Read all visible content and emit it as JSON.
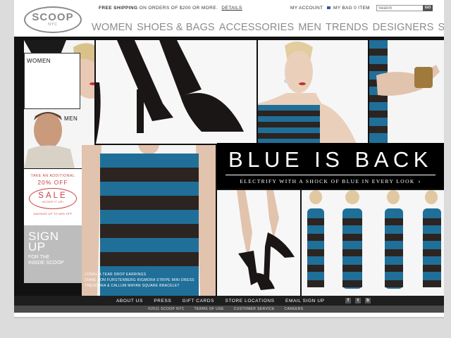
{
  "header": {
    "logo": "SCOOP",
    "logo_sub": "NYC",
    "shipping_bold": "FREE SHIPPING",
    "shipping_text": "ON ORDERS OF $200 OR MORE.",
    "shipping_link": "DETAILS",
    "account": "MY ACCOUNT",
    "bag": "MY BAG 0 ITEM",
    "search_value": "Search",
    "search_button": "GO"
  },
  "nav": [
    "WOMEN",
    "SHOES & BAGS",
    "ACCESSORIES",
    "MEN",
    "TRENDS",
    "DESIGNERS",
    "SALE"
  ],
  "tiles": {
    "women": "WOMEN",
    "men": "MEN"
  },
  "promo": {
    "take": "TAKE AN ADDITIONAL",
    "percent": "20% OFF",
    "sale": "SALE",
    "code": "SCOOP IT UP!",
    "foot": "SAVINGS UP TO 80% OFF"
  },
  "signup": {
    "line1": "SIGN",
    "line2": "UP",
    "line3": "FOR THE",
    "line4": "INSIDE SCOOP"
  },
  "credits": [
    "CORALIA  TEAR DROP EARRINGS",
    "DIANE VON FURSTENBERG  RIGMORA STRIPE MINI DRESS",
    "THEODORA & CALLUM  MAYAN SQUARE BRACELET"
  ],
  "hero": {
    "title": "BLUE IS BACK",
    "subtitle": "ELECTRIFY WITH A SHOCK OF BLUE IN EVERY LOOK"
  },
  "footer": {
    "links": [
      "ABOUT US",
      "PRESS",
      "GIFT CARDS",
      "STORE LOCATIONS",
      "EMAIL SIGN UP"
    ],
    "social": [
      "f",
      "t",
      "b"
    ],
    "sub_links": [
      "©2011 SCOOP NYC",
      "TERMS OF USE",
      "CUSTOMER SERVICE",
      "CAREERS"
    ]
  },
  "colors": {
    "stripe_blue": "#1f6f99",
    "stripe_dark": "#2b2421",
    "accent_red": "#c84142",
    "nav_gray": "#8c8c8c"
  }
}
